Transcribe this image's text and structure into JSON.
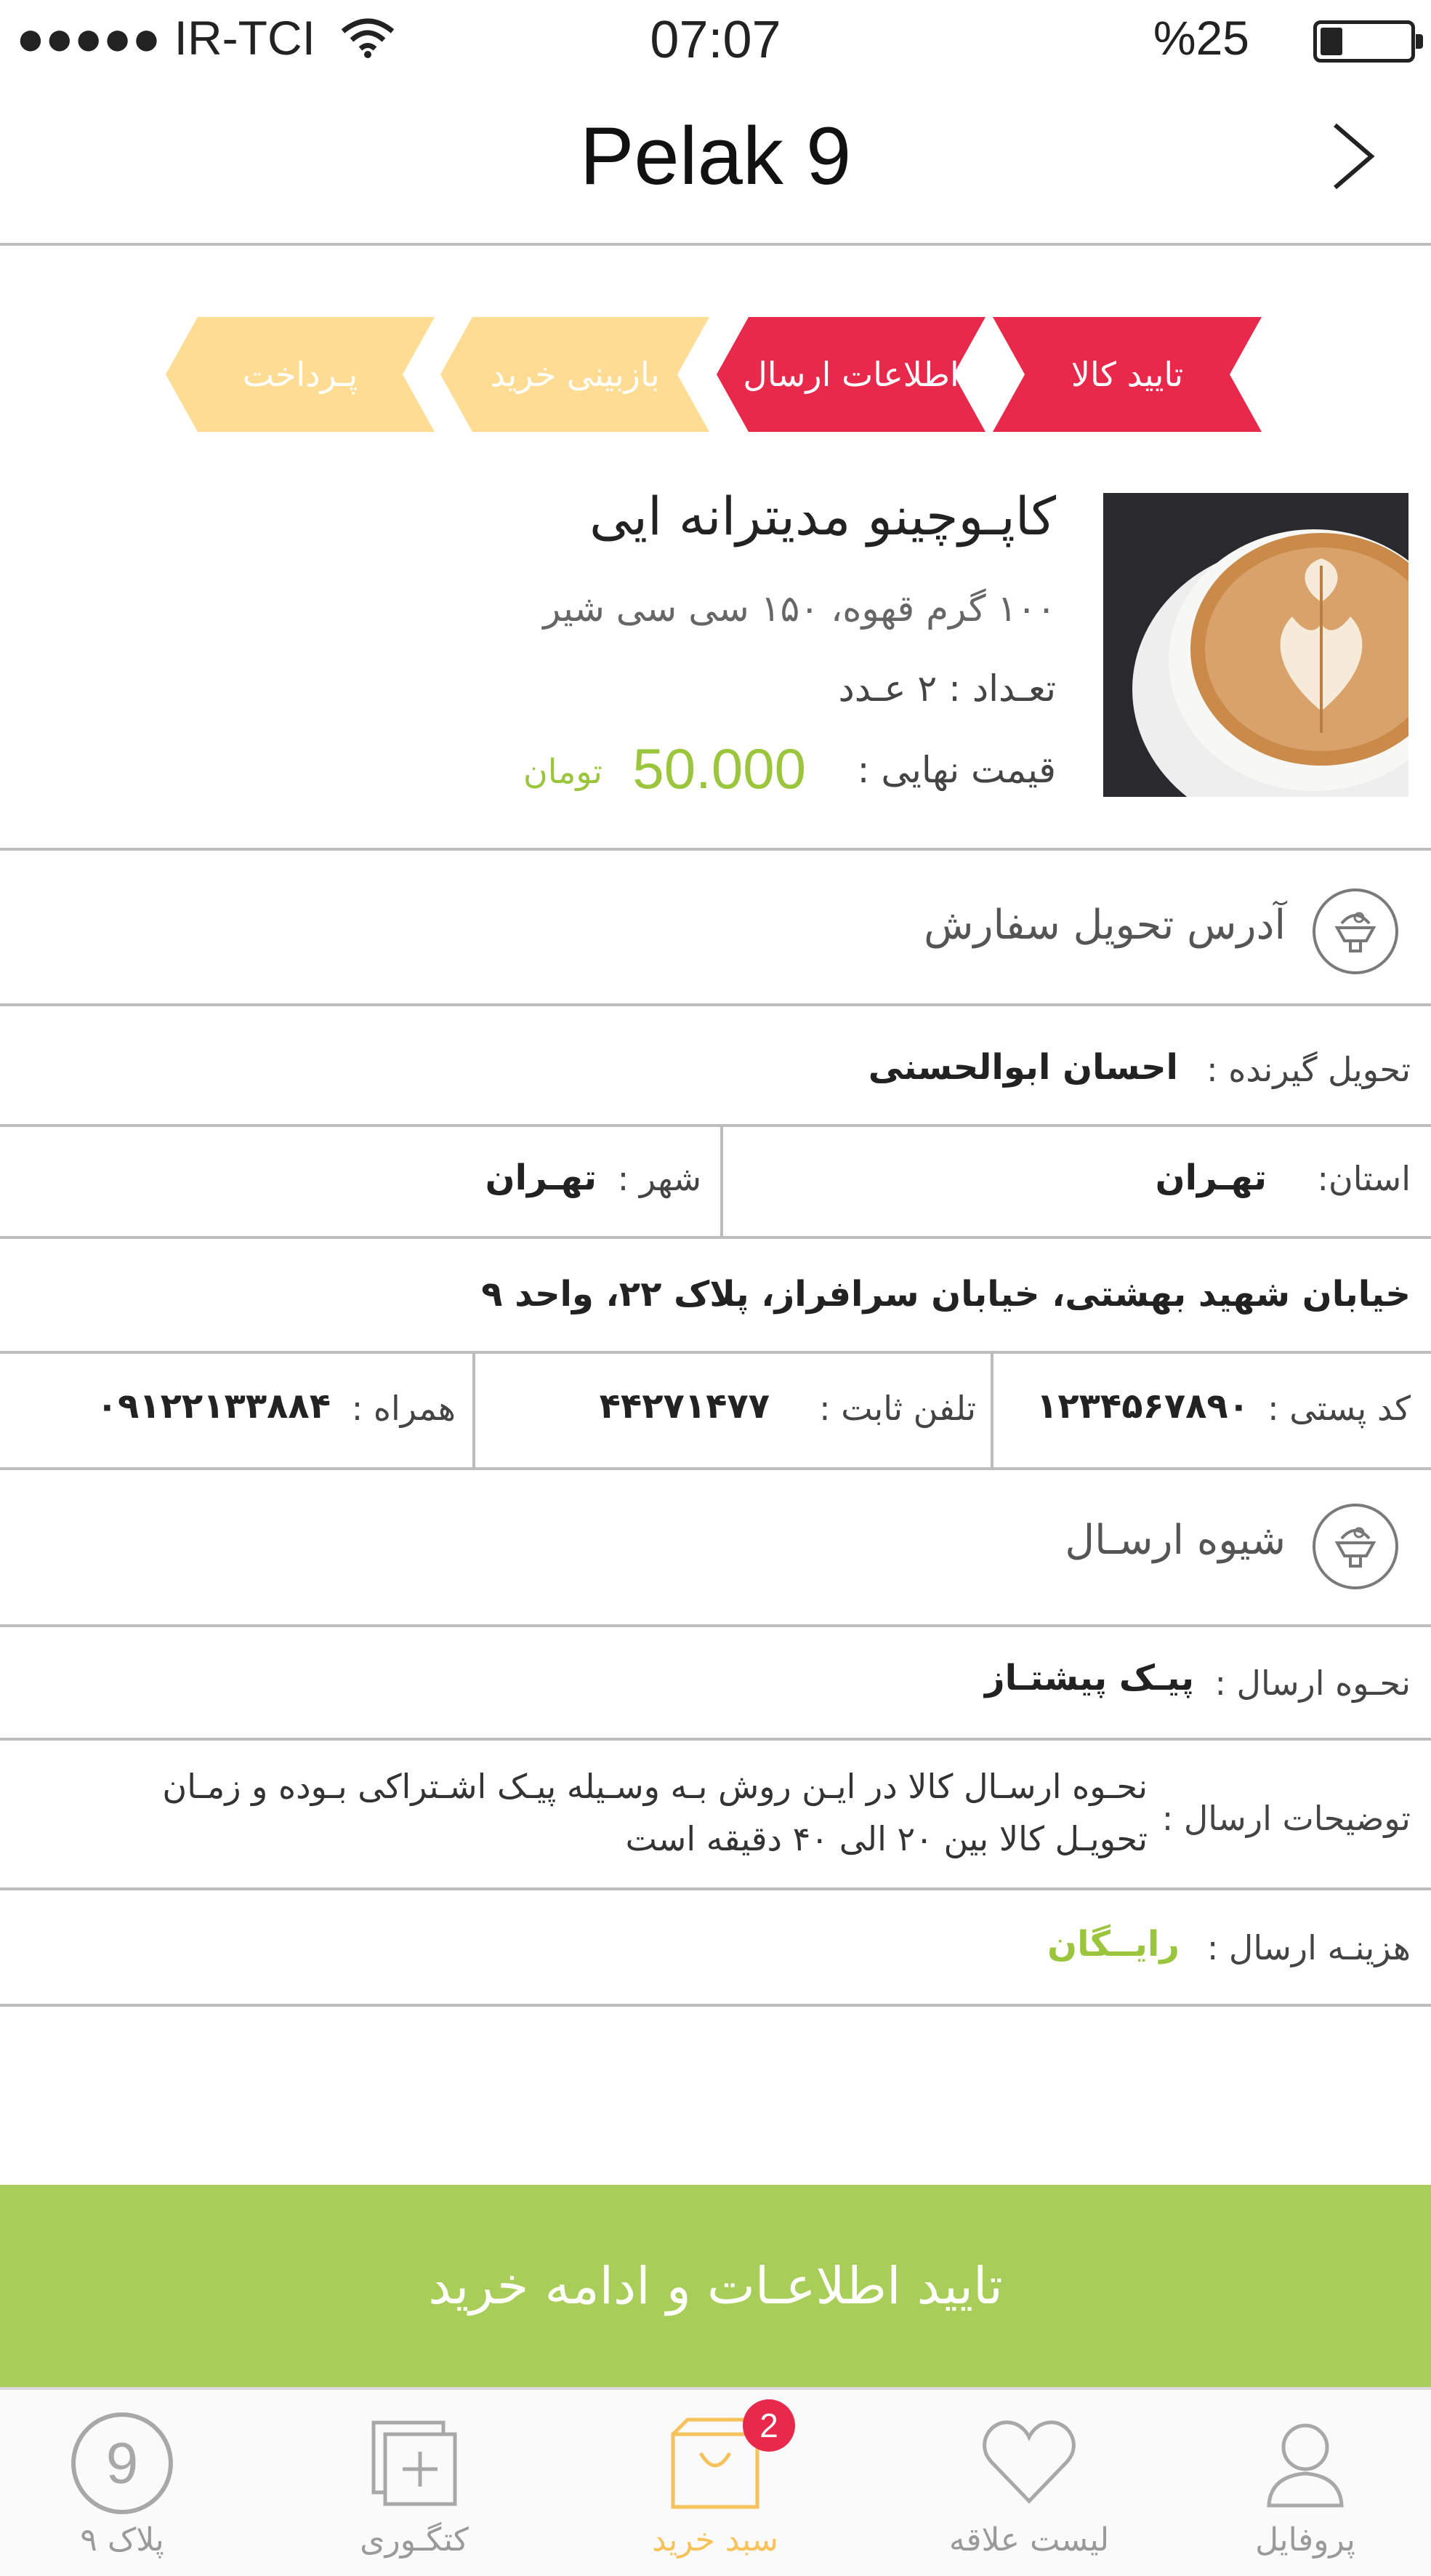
{
  "status_bar": {
    "signal": "●●●●●",
    "carrier": "IR-TCI",
    "time": "07:07",
    "battery": "%25"
  },
  "nav": {
    "title": "Pelak 9",
    "back_icon": "chevron-right-icon"
  },
  "steps": [
    {
      "label": "تایید کالا",
      "state": "done"
    },
    {
      "label": "اطلاعات ارسال",
      "state": "active"
    },
    {
      "label": "بازبینی خرید",
      "state": "pending"
    },
    {
      "label": "پـرداخت",
      "state": "pending"
    }
  ],
  "colors": {
    "step_active": "#e8294b",
    "step_pending": "#fedc93",
    "accent_green": "#9bc53d",
    "cta_green": "#a8ce59",
    "cart_active": "#f6c25b"
  },
  "product": {
    "title": "کاپـوچینو مدیترانه ایی",
    "description": "۱۰۰ گرم قهوه، ۱۵۰ سی سی شیر",
    "quantity": "تعـداد : ۲ عـدد",
    "price_label": "قیمت نهایی :",
    "price": "50.000",
    "currency": "تومان"
  },
  "address_section": {
    "title": "آدرس تحویل سفارش",
    "icon": "delivery-badge-icon",
    "recipient_label": "تحویل گیرنده :",
    "recipient": "احسان ابوالحسنی",
    "province_label": "استان:",
    "province": "تهـران",
    "city_label": "شهر :",
    "city": "تهـران",
    "street": "خیابان شهید بهشتی، خیابان سرافراز، پلاک ۲۲، واحد ۹",
    "postal_label": "کد پستی :",
    "postal": "۱۲۳۴۵۶۷۸۹۰",
    "phone_label": "تلفن ثابت :",
    "phone": "۴۴۲۷۱۴۷۷",
    "mobile_label": "همراه :",
    "mobile": "۰۹۱۲۲۱۳۳۸۸۴"
  },
  "shipping_section": {
    "title": "شیوه ارسـال",
    "icon": "delivery-badge-icon",
    "method_label": "نحـوه ارسال :",
    "method": "پیـک پیشتـاز",
    "desc_label": "توضیحات ارسال :",
    "desc_line1": "نحـوه ارسـال کالا در ایـن روش بـه وسـیله پیـک اشـتراکی بـوده و زمـان",
    "desc_line2": "تحویـل کالا بین ۲۰ الی ۴۰ دقیقه است",
    "cost_label": "هزینـه ارسال :",
    "cost": "رایــگان"
  },
  "cta": {
    "label": "تایید اطلاعـات و ادامه خرید"
  },
  "tabbar": {
    "items": [
      {
        "label": "پروفایل",
        "icon": "profile-icon"
      },
      {
        "label": "لیست علاقه",
        "icon": "heart-icon"
      },
      {
        "label": "سبد خرید",
        "icon": "cart-icon",
        "badge": "2"
      },
      {
        "label": "کتگـوری",
        "icon": "category-icon"
      },
      {
        "label": "پلاک ۹",
        "icon": "pelak9-icon",
        "glyph": "9"
      }
    ]
  }
}
